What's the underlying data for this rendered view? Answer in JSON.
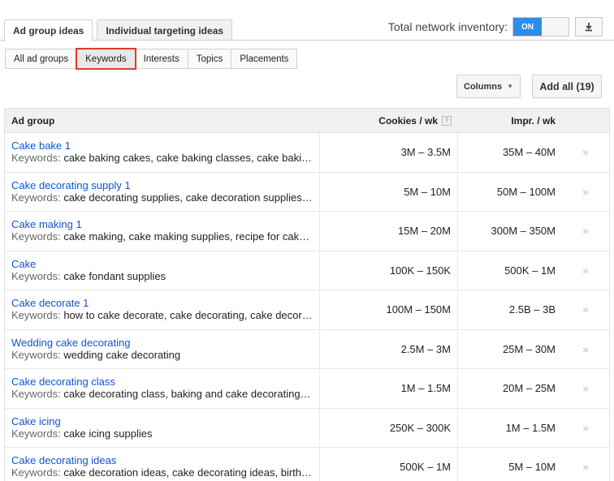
{
  "tabs": [
    {
      "label": "Ad group ideas",
      "active": true
    },
    {
      "label": "Individual targeting ideas",
      "active": false
    }
  ],
  "inventory": {
    "label": "Total network inventory:",
    "toggle": "ON"
  },
  "filters": [
    {
      "label": "All ad groups",
      "selected": false
    },
    {
      "label": "Keywords",
      "selected": true
    },
    {
      "label": "Interests",
      "selected": false
    },
    {
      "label": "Topics",
      "selected": false
    },
    {
      "label": "Placements",
      "selected": false
    }
  ],
  "actions": {
    "columns": "Columns",
    "add_all": "Add all (19)"
  },
  "table": {
    "headers": {
      "group": "Ad group",
      "cookies": "Cookies / wk",
      "help": "?",
      "impr": "Impr. / wk"
    },
    "keyword_label": "Keywords:",
    "arrow": "»",
    "rows": [
      {
        "name": "Cake bake 1",
        "keywords": "cake baking cakes, cake baking classes, cake baking supplies",
        "cookies": "3M – 3.5M",
        "impr": "35M – 40M"
      },
      {
        "name": "Cake decorating supply 1",
        "keywords": "cake decorating supplies, cake decoration supplies, cake supplies",
        "cookies": "5M – 10M",
        "impr": "50M – 100M"
      },
      {
        "name": "Cake making 1",
        "keywords": "cake making, cake making supplies, recipe for cake making",
        "cookies": "15M – 20M",
        "impr": "300M – 350M"
      },
      {
        "name": "Cake",
        "keywords": "cake fondant supplies",
        "cookies": "100K – 150K",
        "impr": "500K – 1M"
      },
      {
        "name": "Cake decorate 1",
        "keywords": "how to cake decorate, cake decorating, cake decorating ideas",
        "cookies": "100M – 150M",
        "impr": "2.5B – 3B"
      },
      {
        "name": "Wedding cake decorating",
        "keywords": "wedding cake decorating",
        "cookies": "2.5M – 3M",
        "impr": "25M – 30M"
      },
      {
        "name": "Cake decorating class",
        "keywords": "cake decorating class, baking and cake decorating classes",
        "cookies": "1M – 1.5M",
        "impr": "20M – 25M"
      },
      {
        "name": "Cake icing",
        "keywords": "cake icing supplies",
        "cookies": "250K – 300K",
        "impr": "1M – 1.5M"
      },
      {
        "name": "Cake decorating ideas",
        "keywords": "cake decoration ideas, cake decorating ideas, birthday cake ideas",
        "cookies": "500K – 1M",
        "impr": "5M – 10M"
      }
    ]
  }
}
